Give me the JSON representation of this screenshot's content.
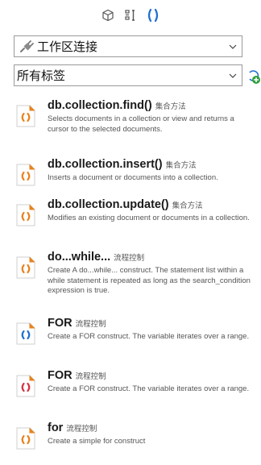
{
  "toolbar": {
    "icons": [
      "cube-icon",
      "snippet-icon",
      "brackets-icon"
    ]
  },
  "connection": {
    "value": "工作区连接",
    "icon": "plug-icon"
  },
  "tag_filter": {
    "value": "所有标签",
    "refresh_icon": "refresh-add-icon"
  },
  "colors": {
    "blue": "#1f6fd1",
    "red": "#d63040",
    "orange": "#e8821e",
    "green": "#2e9e3e"
  },
  "snippets": [
    {
      "name": "db.collection.find()",
      "category": "集合方法",
      "desc": "Selects documents in a collection or view and returns a cursor to the selected documents.",
      "color": "orange"
    },
    {
      "name": "db.collection.insert()",
      "category": "集合方法",
      "desc": "Inserts a document or documents into a collection.",
      "color": "orange"
    },
    {
      "name": "db.collection.update()",
      "category": "集合方法",
      "desc": "Modifies an existing document or documents in a collection.",
      "color": "orange"
    },
    {
      "name": "do...while...",
      "category": "流程控制",
      "desc": "Create A do...while... construct. The statement list within a while statement is repeated as long as the search_condition expression is true.",
      "color": "orange"
    },
    {
      "name": "FOR",
      "category": "流程控制",
      "desc": "Create a FOR construct. The variable iterates over a range.",
      "color": "blue"
    },
    {
      "name": "FOR",
      "category": "流程控制",
      "desc": "Create a FOR construct. The variable iterates over a range.",
      "color": "red"
    },
    {
      "name": "for",
      "category": "流程控制",
      "desc": "Create a simple for construct",
      "color": "orange"
    }
  ]
}
